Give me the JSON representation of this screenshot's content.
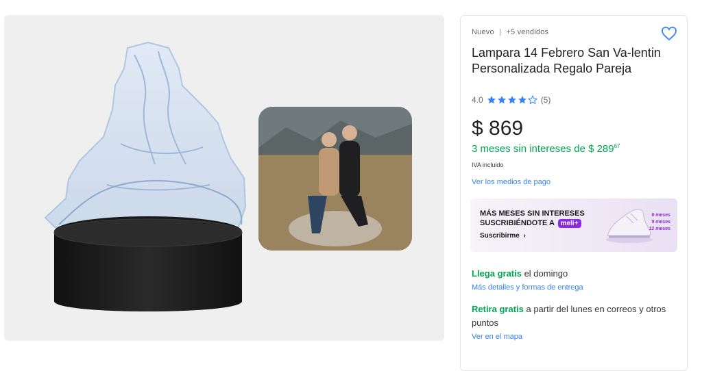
{
  "product": {
    "condition": "Nuevo",
    "separator": "|",
    "sold": "+5 vendidos",
    "title": "Lampara 14 Febrero San Va-lentin Personalizada Regalo Pareja",
    "rating_value": "4.0",
    "rating_count": "(5)",
    "rating_stars": 4,
    "price": "$ 869",
    "installments_prefix": "3 meses sin intereses de $ 289",
    "installments_cents": "67",
    "tax_note": "IVA incluido",
    "payment_link": "Ver los medios de pago"
  },
  "promo": {
    "line1": "MÁS MESES SIN INTERESES",
    "line2": "SUSCRIBIÉNDOTE A",
    "badge": "meli+",
    "cta": "Suscribirme",
    "months_6": "6 meses",
    "months_9": "9 meses",
    "months_12": "12 meses"
  },
  "shipping": {
    "arrive_bold": "Llega gratis",
    "arrive_rest": " el domingo",
    "details_link": "Más detalles y formas de entrega",
    "pickup_bold": "Retira gratis",
    "pickup_rest": " a partir del lunes en correos y otros puntos",
    "map_link": "Ver en el mapa"
  },
  "colors": {
    "accent_blue": "#3483fa",
    "green": "#00a650",
    "meli_purple": "#8a2be2"
  },
  "icons": {
    "favorite": "heart-icon",
    "star": "star-icon",
    "chevron": "chevron-right-icon"
  }
}
